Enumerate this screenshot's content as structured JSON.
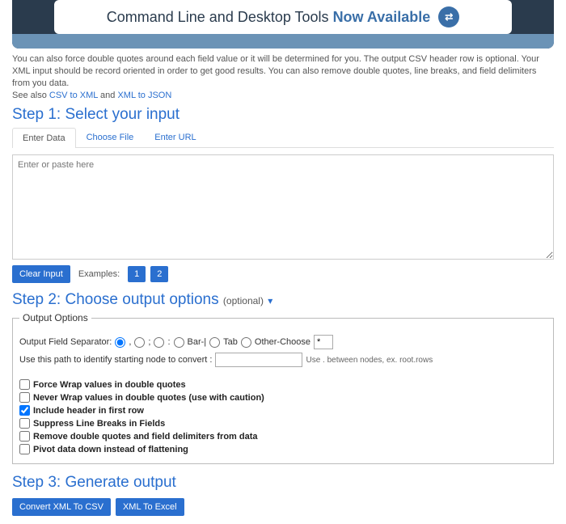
{
  "banner": {
    "text_main": "Command Line and Desktop Tools ",
    "text_avail": "Now Available",
    "icon_glyph": "⇄"
  },
  "intro": {
    "line1": "You can also force double quotes around each field value or it will be determined for you. The output CSV header row is optional. Your XML input should be record oriented in order to get good results. You can also remove double quotes, line breaks, and field delimiters from you data.",
    "seealso_prefix": "See also ",
    "link1": "CSV to XML",
    "and": " and ",
    "link2": "XML to JSON"
  },
  "step1": {
    "title": "Step 1: Select your input"
  },
  "tabs": {
    "enter_data": "Enter Data",
    "choose_file": "Choose File",
    "enter_url": "Enter URL"
  },
  "textarea": {
    "placeholder": "Enter or paste here"
  },
  "buttons": {
    "clear_input": "Clear Input",
    "examples_label": "Examples:",
    "ex1": "1",
    "ex2": "2"
  },
  "step2": {
    "title": "Step 2: Choose output options ",
    "optional": "(optional)",
    "caret": "▾"
  },
  "options": {
    "legend": "Output Options",
    "field_sep_label": "Output Field Separator:",
    "sep_comma": ",",
    "sep_semicolon": ";",
    "sep_colon": ":",
    "sep_bar": "Bar-|",
    "sep_tab": "Tab",
    "sep_other": "Other-Choose",
    "sep_other_value": "*",
    "path_label": "Use this path to identify starting node to convert :",
    "path_hint": "Use . between nodes, ex. root.rows",
    "chk_force_wrap": "Force Wrap values in double quotes",
    "chk_never_wrap": "Never Wrap values in double quotes (use with caution)",
    "chk_include_header": "Include header in first row",
    "chk_suppress_breaks": "Suppress Line Breaks in Fields",
    "chk_remove_quotes": "Remove double quotes and field delimiters from data",
    "chk_pivot": "Pivot data down instead of flattening"
  },
  "step3": {
    "title": "Step 3: Generate output"
  },
  "generate": {
    "to_csv": "Convert XML To CSV",
    "to_excel": "XML To Excel"
  }
}
